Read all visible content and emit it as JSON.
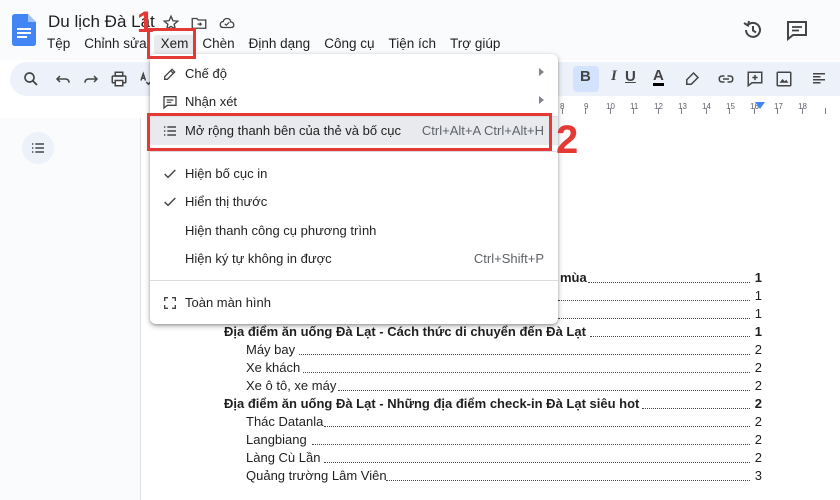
{
  "header": {
    "doc_title": "Du lịch Đà Lạt",
    "menus": [
      "Tệp",
      "Chỉnh sửa",
      "Xem",
      "Chèn",
      "Định dạng",
      "Công cụ",
      "Tiện ích",
      "Trợ giúp"
    ],
    "active_menu": "Xem"
  },
  "toolbar": {
    "icons": [
      "search-icon",
      "undo-icon",
      "redo-icon",
      "print-icon",
      "paint-format-icon"
    ],
    "bold_label": "B",
    "italic_label": "I",
    "underline_label": "U",
    "text_color_label": "A"
  },
  "ruler": {
    "marks": [
      "8",
      "9",
      "10",
      "11",
      "12",
      "13",
      "14",
      "15",
      "16",
      "17",
      "18"
    ]
  },
  "menu": {
    "items": [
      {
        "icon": "pencil-icon",
        "label": "Chế độ",
        "submenu": true
      },
      {
        "icon": "comment-icon",
        "label": "Nhận xét",
        "submenu": true
      },
      {
        "icon": "list-icon",
        "label": "Mở rộng thanh bên của thẻ và bố cục",
        "shortcut": "Ctrl+Alt+A Ctrl+Alt+H"
      },
      {
        "icon": "check-icon",
        "label": "Hiện bố cục in"
      },
      {
        "icon": "check-icon",
        "label": "Hiển thị thước"
      },
      {
        "icon": "",
        "label": "Hiện thanh công cụ phương trình"
      },
      {
        "icon": "",
        "label": "Hiện ký tự không in được",
        "shortcut": "Ctrl+Shift+P"
      },
      {
        "icon": "fullscreen-icon",
        "label": "Toàn màn hình"
      }
    ]
  },
  "toc": [
    {
      "label": "mùa",
      "page": "1",
      "bold": true,
      "partial": true
    },
    {
      "label": "",
      "page": "1",
      "bold": false,
      "partial": true
    },
    {
      "label": "",
      "page": "1",
      "bold": false,
      "partial": true
    },
    {
      "label": "Địa điểm ăn uống Đà Lạt - Cách thức di chuyển đến Đà Lạt",
      "page": "1",
      "bold": true
    },
    {
      "label": "Máy bay",
      "page": "2",
      "bold": false
    },
    {
      "label": "Xe khách",
      "page": "2",
      "bold": false
    },
    {
      "label": "Xe ô tô, xe máy",
      "page": "2",
      "bold": false
    },
    {
      "label": "Địa điểm ăn uống Đà Lạt - Những địa điểm check-in Đà Lạt siêu hot",
      "page": "2",
      "bold": true
    },
    {
      "label": "Thác Datanla",
      "page": "2",
      "bold": false
    },
    {
      "label": "Langbiang",
      "page": "2",
      "bold": false
    },
    {
      "label": "Làng Cù Lần",
      "page": "2",
      "bold": false
    },
    {
      "label": "Quảng trường Lâm Viên",
      "page": "3",
      "bold": false
    }
  ],
  "annotations": {
    "step1": "1",
    "step2": "2",
    "accent": "#e53935"
  }
}
